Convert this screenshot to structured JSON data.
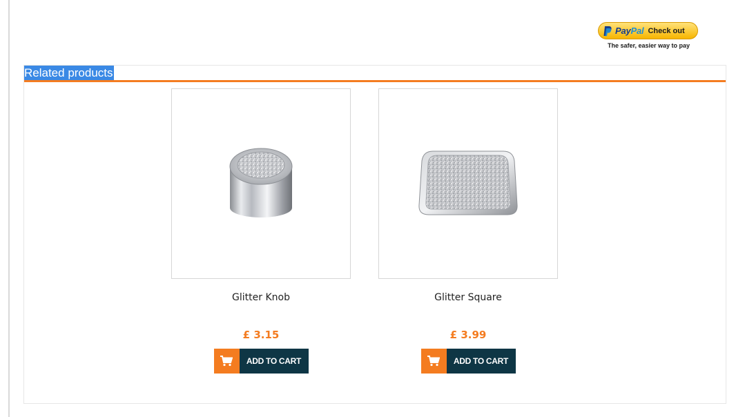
{
  "paypal": {
    "word_pay": "Pay",
    "word_pal": "Pal",
    "button_label": "Check out",
    "tagline": "The safer, easier way to pay"
  },
  "related": {
    "title": "Related products",
    "products": [
      {
        "name": "Glitter Knob",
        "price": "£ 3.15",
        "add_to_cart_label": "ADD TO CART",
        "image_icon": "glitter-knob-image"
      },
      {
        "name": "Glitter Square",
        "price": "£ 3.99",
        "add_to_cart_label": "ADD TO CART",
        "image_icon": "glitter-square-image"
      }
    ]
  },
  "colors": {
    "accent_orange": "#f47c20",
    "button_dark": "#0e3645",
    "title_highlight": "#3a89e5",
    "paypal_yellow": "#ffc439"
  }
}
